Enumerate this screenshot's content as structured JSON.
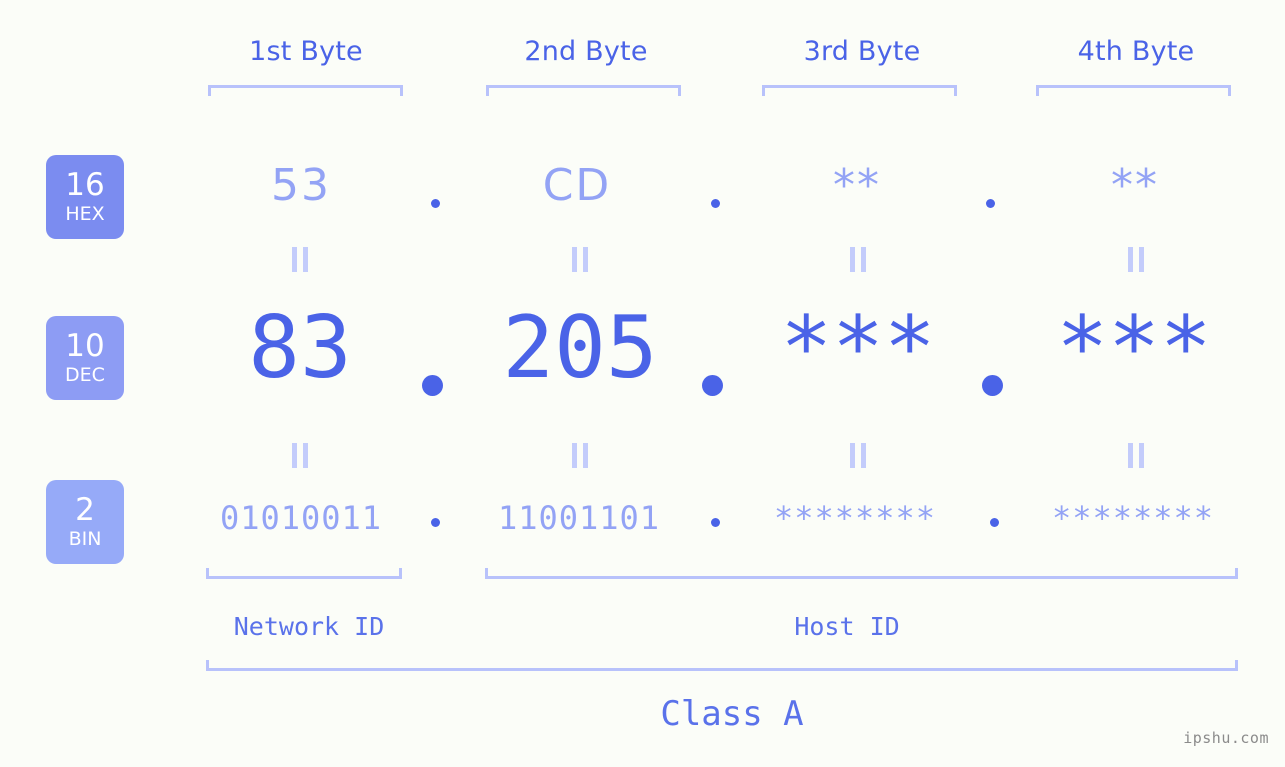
{
  "meta": {
    "background_color": "#fbfdf8",
    "accent_strong": "#4a63e7",
    "accent_light": "#93a3f5",
    "bracket_color": "#b8c2fb",
    "watermark": "ipshu.com"
  },
  "byte_headers": [
    {
      "label": "1st Byte"
    },
    {
      "label": "2nd Byte"
    },
    {
      "label": "3rd Byte"
    },
    {
      "label": "4th Byte"
    }
  ],
  "bases": [
    {
      "number": "16",
      "name": "HEX",
      "color": "#7b8cf0"
    },
    {
      "number": "10",
      "name": "DEC",
      "color": "#8d9cf4"
    },
    {
      "number": "2",
      "name": "BIN",
      "color": "#96aaf8"
    }
  ],
  "rows": {
    "hex": {
      "base_number": "16",
      "base_name": "HEX",
      "values": [
        "53",
        "CD",
        "**",
        "**"
      ],
      "separator": "."
    },
    "dec": {
      "base_number": "10",
      "base_name": "DEC",
      "values": [
        "83",
        "205",
        "***",
        "***"
      ],
      "separator": "."
    },
    "bin": {
      "base_number": "2",
      "base_name": "BIN",
      "values": [
        "01010011",
        "11001101",
        "********",
        "********"
      ],
      "separator": "."
    }
  },
  "equals_marker": "||",
  "groups": [
    {
      "label": "Network ID"
    },
    {
      "label": "Host ID"
    }
  ],
  "class": {
    "label": "Class A"
  }
}
